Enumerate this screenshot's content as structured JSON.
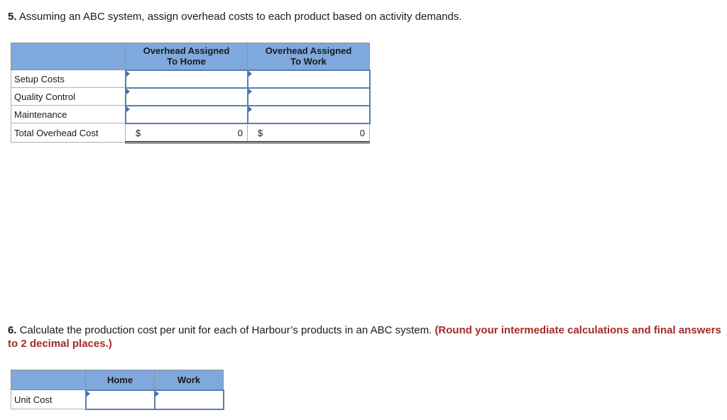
{
  "q5": {
    "number": "5.",
    "text": " Assuming an ABC system, assign overhead costs to each product based on activity demands."
  },
  "table5": {
    "headers": [
      "",
      "Overhead Assigned\nTo Home",
      "Overhead Assigned\nTo Work"
    ],
    "header_lines": [
      [
        "Overhead Assigned",
        "To Home"
      ],
      [
        "Overhead Assigned",
        "To Work"
      ]
    ],
    "rows": [
      {
        "label": "Setup Costs",
        "home": "",
        "work": ""
      },
      {
        "label": "Quality Control",
        "home": "",
        "work": ""
      },
      {
        "label": "Maintenance",
        "home": "",
        "work": ""
      }
    ],
    "total": {
      "label": "Total Overhead Cost",
      "currency": "$",
      "home": "0",
      "work": "0"
    }
  },
  "q6": {
    "number": "6.",
    "text": " Calculate the production cost per unit for each of Harbour’s products in an ABC system. ",
    "note": "(Round your intermediate calculations and final answers to 2 decimal places.)"
  },
  "table6": {
    "headers": [
      "",
      "Home",
      "Work"
    ],
    "rows": [
      {
        "label": "Unit Cost",
        "home": "",
        "work": ""
      }
    ]
  },
  "colors": {
    "header_bg": "#7fa9dd",
    "input_border": "#5a7fb0",
    "note_red": "#a52a2a"
  }
}
